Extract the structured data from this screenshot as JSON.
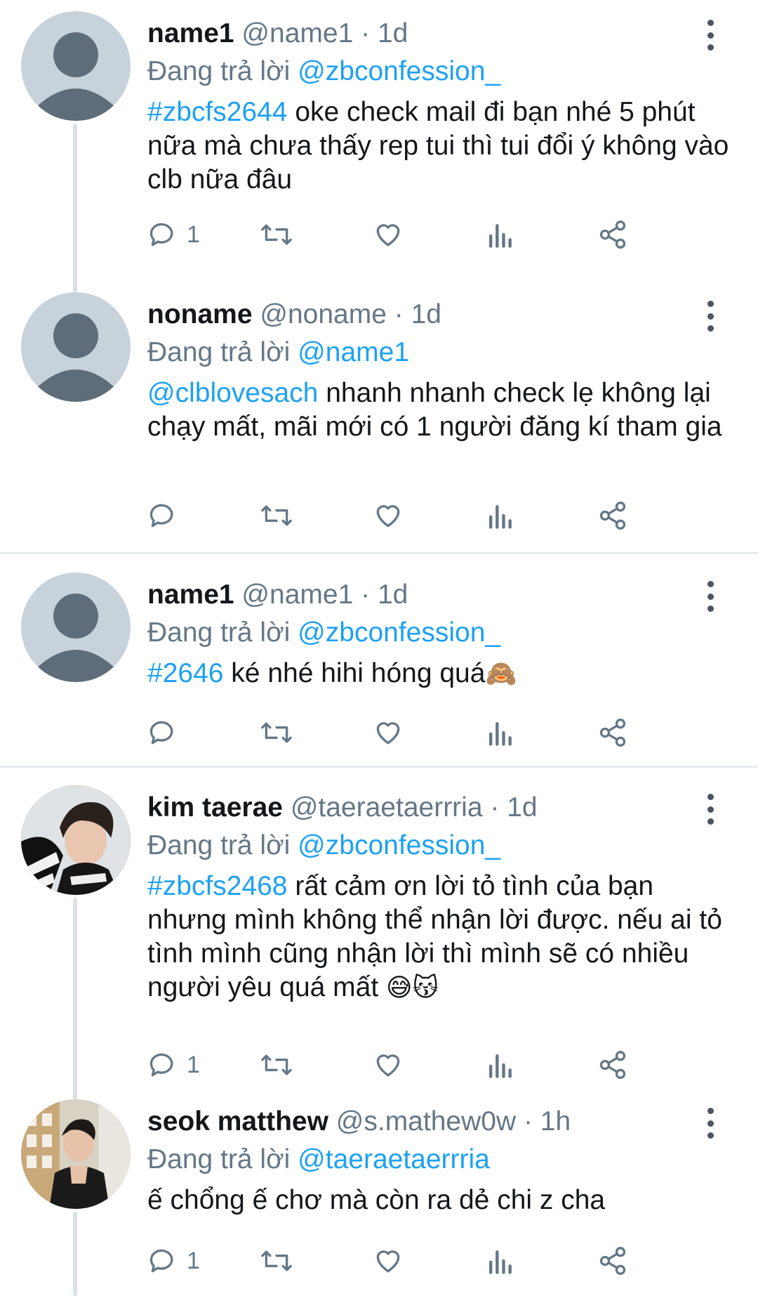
{
  "replying_label": "Đang trả lời",
  "tweets": [
    {
      "name": "name1",
      "handle": "@name1",
      "time": "1d",
      "reply_to": "@zbconfession_",
      "tag": "#zbcfs2644",
      "text": " oke check mail đi bạn nhé 5 phút nữa mà chưa thấy rep tui thì tui đổi ý không vào clb nữa đâu",
      "reply_count": "1"
    },
    {
      "name": "noname",
      "handle": "@noname",
      "time": "1d",
      "reply_to": "@name1",
      "tag": "@clblovesach",
      "text": " nhanh nhanh check lẹ không lại chạy mất, mãi mới có 1 người đăng kí tham gia",
      "reply_count": ""
    },
    {
      "name": "name1",
      "handle": "@name1",
      "time": "1d",
      "reply_to": "@zbconfession_",
      "tag": "#2646",
      "text": " ké nhé hihi hóng quá",
      "emoji": "🙈",
      "reply_count": ""
    },
    {
      "name": "kim taerae",
      "handle": "@taeraetaerrria",
      "time": "1d",
      "reply_to": "@zbconfession_",
      "tag": "#zbcfs2468",
      "text": " rất cảm ơn lời tỏ tình của bạn nhưng mình không thể nhận lời được. nếu ai tỏ tình mình cũng nhận lời thì mình sẽ có nhiều người yêu quá mất ",
      "emoji": "😅😽",
      "reply_count": "1"
    },
    {
      "name": "seok matthew",
      "handle": "@s.mathew0w",
      "time": "1h",
      "reply_to": "@taeraetaerrria",
      "tag": "",
      "text": "ế chổng ế chơ mà còn ra dẻ chi z cha",
      "reply_count": "1"
    }
  ],
  "icons": [
    "reply-icon",
    "retweet-icon",
    "like-icon",
    "analytics-icon",
    "share-icon",
    "more-options-icon"
  ],
  "colors": {
    "link": "#1da1f2",
    "muted": "#657786",
    "divider": "#e6ecf0",
    "thread_line": "#d9e1e8"
  }
}
